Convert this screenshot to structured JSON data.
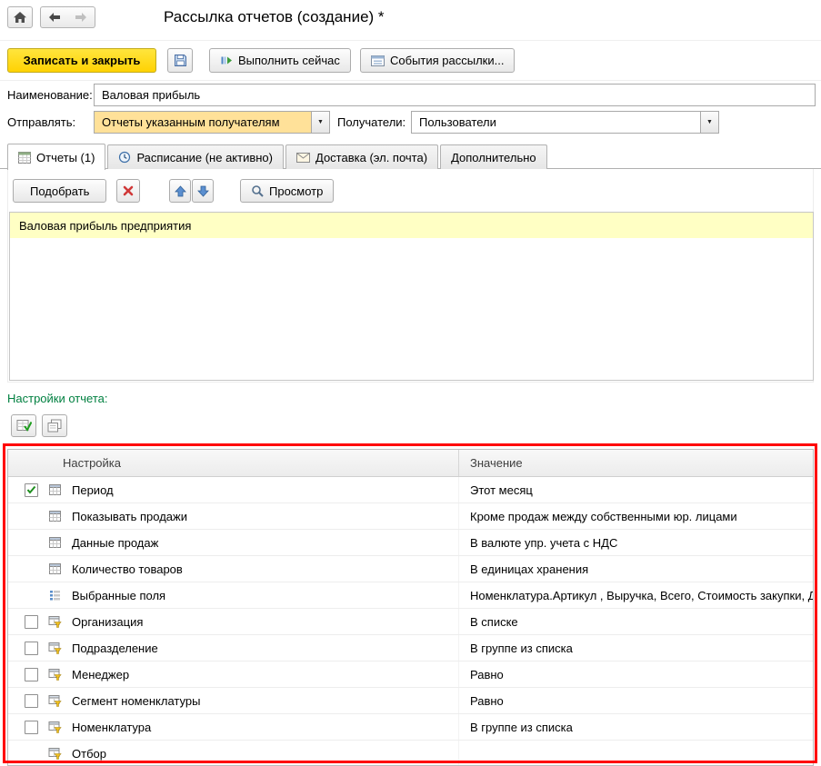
{
  "window": {
    "title": "Рассылка отчетов (создание) *"
  },
  "glyphs": {
    "dropdown_arrow": "▼"
  },
  "toolbar": {
    "save_close": "Записать и закрыть",
    "run_now": "Выполнить сейчас",
    "events": "События рассылки..."
  },
  "form": {
    "name_label": "Наименование:",
    "name_value": "Валовая прибыль",
    "send_label": "Отправлять:",
    "send_value": "Отчеты указанным получателям",
    "recipients_label": "Получатели:",
    "recipients_value": "Пользователи"
  },
  "tabs": [
    {
      "id": "reports",
      "label": "Отчеты (1)",
      "icon": "report-icon",
      "active": true
    },
    {
      "id": "schedule",
      "label": "Расписание (не активно)",
      "icon": "schedule-icon",
      "active": false
    },
    {
      "id": "delivery",
      "label": "Доставка (эл. почта)",
      "icon": "delivery-icon",
      "active": false
    },
    {
      "id": "more",
      "label": "Дополнительно",
      "icon": "",
      "active": false
    }
  ],
  "reports": {
    "pick": "Подобрать",
    "preview": "Просмотр",
    "items": [
      "Валовая прибыль предприятия"
    ]
  },
  "settings": {
    "label": "Настройки отчета:",
    "columns": [
      "Настройка",
      "Значение"
    ],
    "rows": [
      {
        "checkbox": "checked",
        "icon": "parameter-icon",
        "name": "Период",
        "value": "Этот месяц"
      },
      {
        "checkbox": "none",
        "icon": "parameter-icon",
        "name": "Показывать продажи",
        "value": "Кроме продаж между собственными юр. лицами"
      },
      {
        "checkbox": "none",
        "icon": "parameter-icon",
        "name": "Данные продаж",
        "value": "В валюте упр. учета с НДС"
      },
      {
        "checkbox": "none",
        "icon": "parameter-icon",
        "name": "Количество товаров",
        "value": "В единицах хранения"
      },
      {
        "checkbox": "none",
        "icon": "fields-icon",
        "name": "Выбранные поля",
        "value": "Номенклатура.Артикул , Выручка, Всего, Стоимость закупки, Д"
      },
      {
        "checkbox": "unchecked",
        "icon": "filter-icon",
        "name": "Организация",
        "value": "В списке"
      },
      {
        "checkbox": "unchecked",
        "icon": "filter-icon",
        "name": "Подразделение",
        "value": "В группе из списка"
      },
      {
        "checkbox": "unchecked",
        "icon": "filter-icon",
        "name": "Менеджер",
        "value": "Равно"
      },
      {
        "checkbox": "unchecked",
        "icon": "filter-icon",
        "name": "Сегмент номенклатуры",
        "value": "Равно"
      },
      {
        "checkbox": "unchecked",
        "icon": "filter-icon",
        "name": "Номенклатура",
        "value": "В группе из списка"
      },
      {
        "checkbox": "none",
        "icon": "filter-icon",
        "name": "Отбор",
        "value": ""
      }
    ]
  },
  "colors": {
    "primary_button": "#ffd800",
    "highlight_field": "#ffe199",
    "selected_row": "#ffffc4",
    "settings_label": "#008040",
    "annotation": "#ff0000"
  }
}
